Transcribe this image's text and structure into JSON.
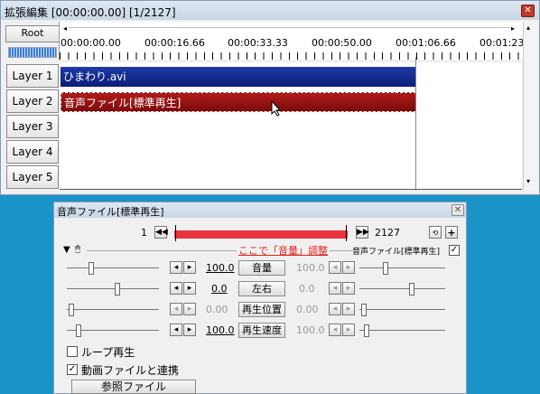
{
  "timeline": {
    "title": "拡張編集 [00:00:00.00] [1/2127]",
    "root_label": "Root",
    "ticks": [
      "00:00:00.00",
      "00:00:16.66",
      "00:00:33.33",
      "00:00:50.00",
      "00:01:06.66",
      "00:01:23"
    ],
    "layers": [
      "Layer 1",
      "Layer 2",
      "Layer 3",
      "Layer 4",
      "Layer 5"
    ],
    "clips": {
      "video": "ひまわり.avi",
      "audio": "音声ファイル[標準再生]"
    }
  },
  "dialog": {
    "title": "音声ファイル[標準再生]",
    "frame_start": "1",
    "frame_end": "2127",
    "annotation": "ここで「音量」調整",
    "object_label": "音声ファイル[標準再生]",
    "params": [
      {
        "label": "音量",
        "left": "100.0",
        "right": "100.0"
      },
      {
        "label": "左右",
        "left": "0.0",
        "right": "0.0"
      },
      {
        "label": "再生位置",
        "left": "0.00",
        "right": "0.00"
      },
      {
        "label": "再生速度",
        "left": "100.0",
        "right": "100.0"
      }
    ],
    "loop_label": "ループ再生",
    "link_label": "動画ファイルと連携",
    "ref_button": "参照ファイル"
  }
}
